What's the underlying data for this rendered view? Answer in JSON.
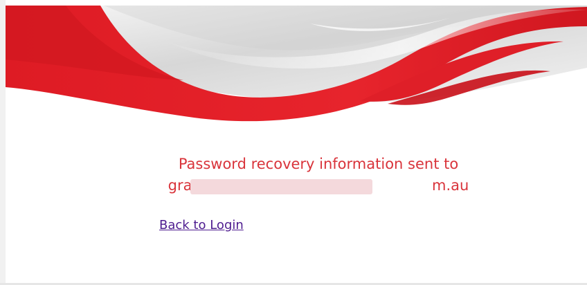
{
  "page": {
    "message": {
      "line1": "Password recovery information sent to",
      "email": "gra                                 m.au",
      "redacted": true
    },
    "back_link": {
      "label": "Back to Login"
    }
  },
  "colors": {
    "brand_red": "#e21c25",
    "message_red": "#d9343b",
    "link_purple": "#4d1b8f"
  },
  "icons": [
    "swoosh-banner"
  ]
}
